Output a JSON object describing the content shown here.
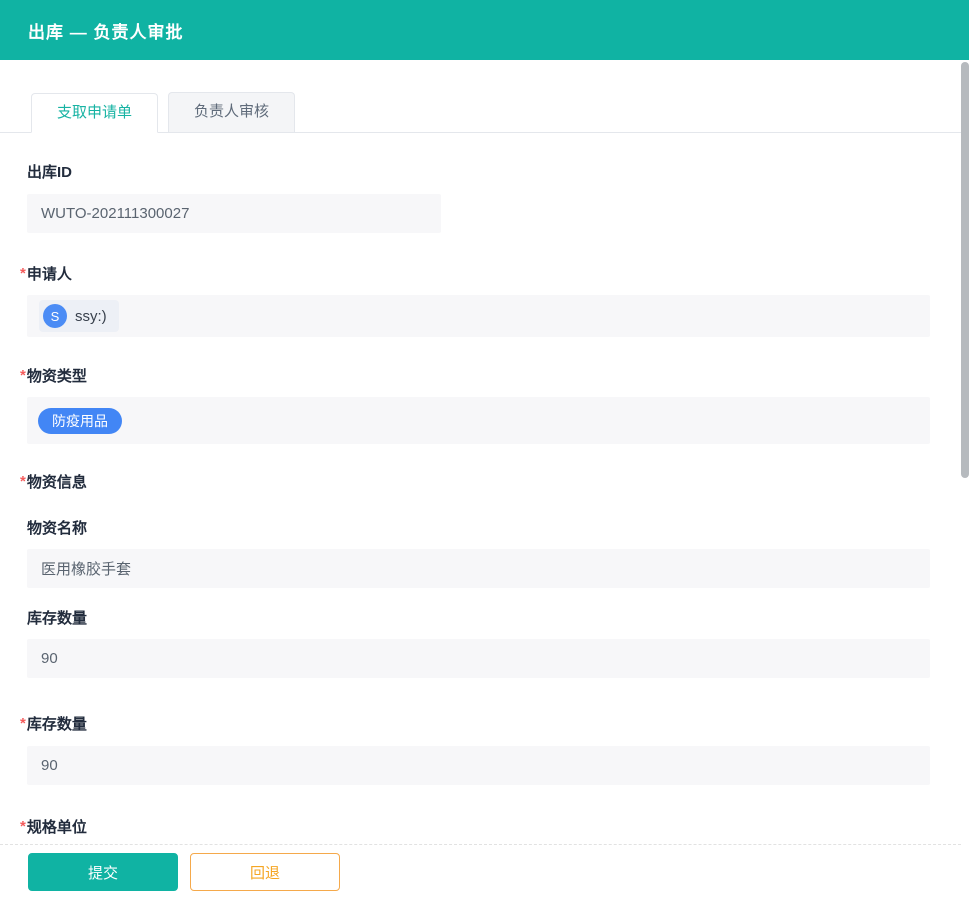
{
  "colors": {
    "accent_teal": "#10b3a3",
    "tag_blue": "#4286f5",
    "avatar_blue": "#4b8cf5",
    "warn_orange": "#f5a623",
    "required_red": "#f45c5c"
  },
  "required_mark": "*",
  "header": {
    "title": "出库 — 负责人审批"
  },
  "tabs": {
    "items": [
      {
        "label": "支取申请单",
        "active": true
      },
      {
        "label": "负责人审核",
        "active": false
      }
    ]
  },
  "form": {
    "outbound_id": {
      "label": "出库ID",
      "value": "WUTO-202111300027"
    },
    "applicant": {
      "label": "申请人",
      "avatar_initial": "S",
      "name": "ssy:)"
    },
    "material_type": {
      "label": "物资类型",
      "tag": "防疫用品"
    },
    "material_info": {
      "label": "物资信息",
      "material_name": {
        "label": "物资名称",
        "value": "医用橡胶手套"
      },
      "stock_quantity": {
        "label": "库存数量",
        "value": "90"
      }
    },
    "stock_quantity": {
      "label": "库存数量",
      "value": "90"
    },
    "spec_unit": {
      "label": "规格单位"
    }
  },
  "footer": {
    "submit_label": "提交",
    "return_label": "回退"
  }
}
